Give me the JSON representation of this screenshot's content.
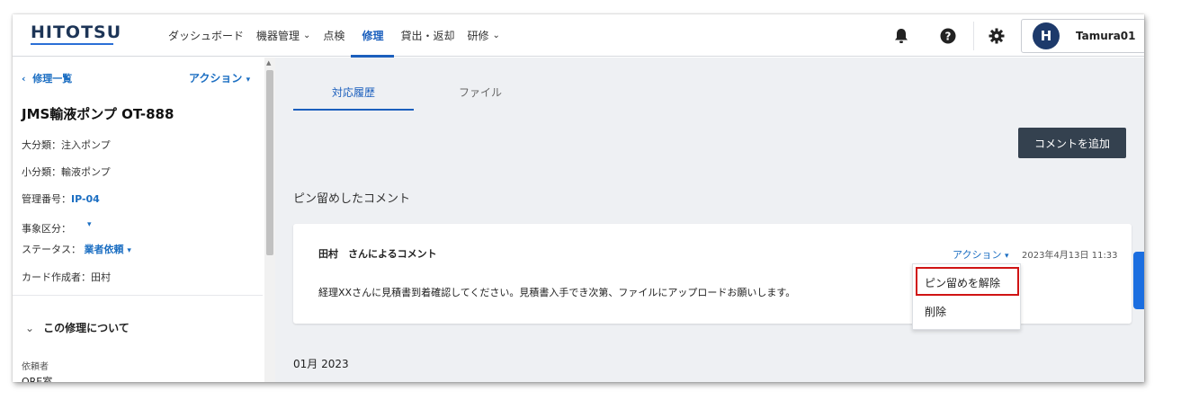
{
  "header": {
    "logo": "HITOTSU",
    "nav": [
      {
        "label": "ダッシュボード"
      },
      {
        "label": "機器管理"
      },
      {
        "label": "点検"
      },
      {
        "label": "修理"
      },
      {
        "label": "貸出・返却"
      },
      {
        "label": "研修"
      }
    ],
    "user": {
      "initial": "H",
      "name": "Tamura01"
    }
  },
  "sidebar": {
    "back_label": "修理一覧",
    "action_label": "アクション",
    "title": "JMS輸液ポンプ OT-888",
    "fields": {
      "category_major": "大分類：注入ポンプ",
      "category_minor": "小分類：輸液ポンプ",
      "mgmt_label": "管理番号：",
      "mgmt_value": "IP-04",
      "event_label": "事象区分：",
      "status_label": "ステータス：",
      "status_value": "業者依頼",
      "creator": "カード作成者：田村"
    },
    "section_title": "この修理について",
    "requester_label": "依頼者",
    "requester_value": "ORE室"
  },
  "main": {
    "tabs": [
      {
        "label": "対応履歴",
        "active": true
      },
      {
        "label": "ファイル",
        "active": false
      }
    ],
    "add_comment_button": "コメントを追加",
    "pinned_heading": "ピン留めしたコメント",
    "card": {
      "author": "田村　さんによるコメント",
      "action_label": "アクション",
      "date": "2023年4月13日 11:33",
      "body": "経理XXさんに見積書到着確認してください。見積書入手でき次第、ファイルにアップロードお願いします。"
    },
    "dropdown": {
      "items": [
        "ピン留めを解除",
        "削除"
      ]
    },
    "month_label": "01月 2023"
  },
  "colors": {
    "accent": "#1b5fbd",
    "button_dark": "#34414f",
    "highlight_red": "#d01414"
  }
}
